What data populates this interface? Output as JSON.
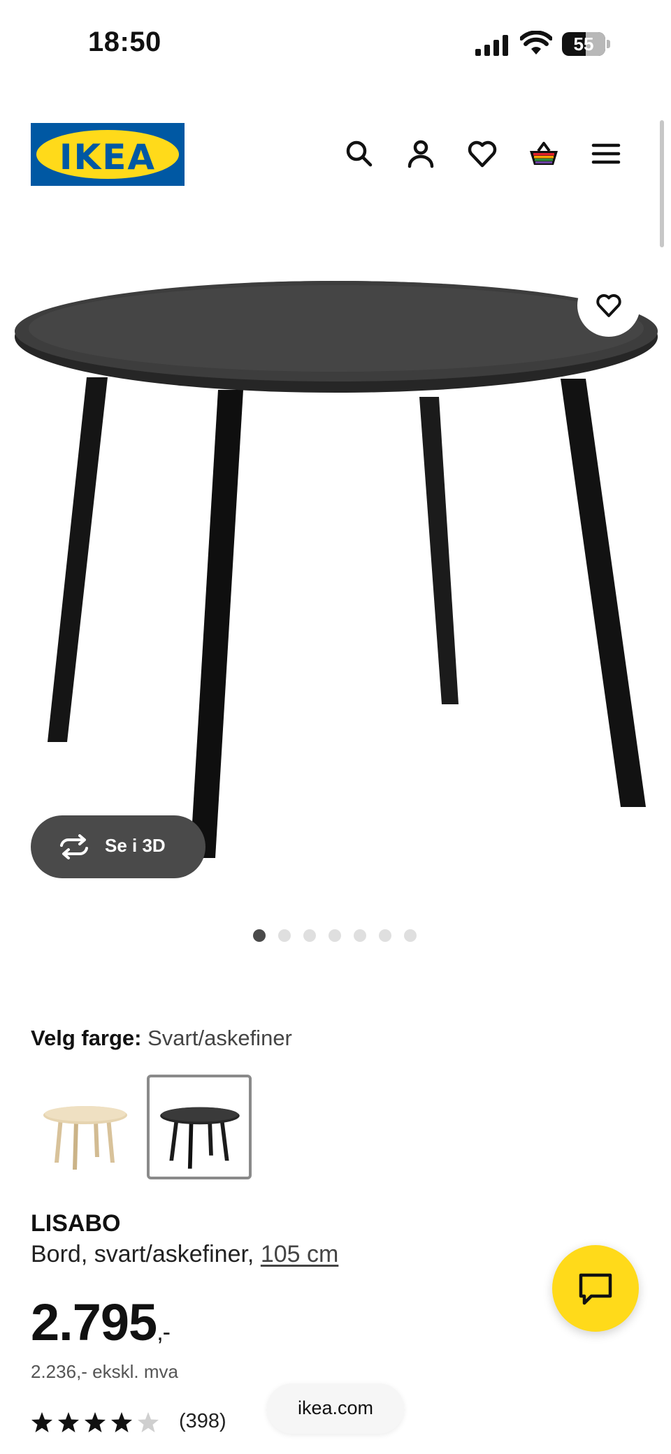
{
  "status_bar": {
    "time": "18:50",
    "battery": "55"
  },
  "header": {
    "logo_text": "IKEA",
    "icons": [
      "search-icon",
      "account-icon",
      "wishlist-icon",
      "cart-icon",
      "menu-icon"
    ]
  },
  "gallery": {
    "see_3d_label": "Se i 3D",
    "dot_count": 7,
    "active_dot": 1
  },
  "color_select": {
    "label": "Velg farge:",
    "value": "Svart/askefiner",
    "swatches": [
      {
        "name": "birch",
        "selected": false
      },
      {
        "name": "black",
        "selected": true
      }
    ]
  },
  "product": {
    "name": "LISABO",
    "description": "Bord, svart/askefiner,",
    "size_link": "105 cm",
    "price_main": "2.795",
    "price_suffix": ",-",
    "price_ex_vat": "2.236,- ekskl. mva",
    "rating": 4.5,
    "reviews": "(398)"
  },
  "browser": {
    "url": "ikea.com"
  },
  "colors": {
    "ikea_blue": "#0058a3",
    "ikea_yellow": "#ffda1a"
  }
}
